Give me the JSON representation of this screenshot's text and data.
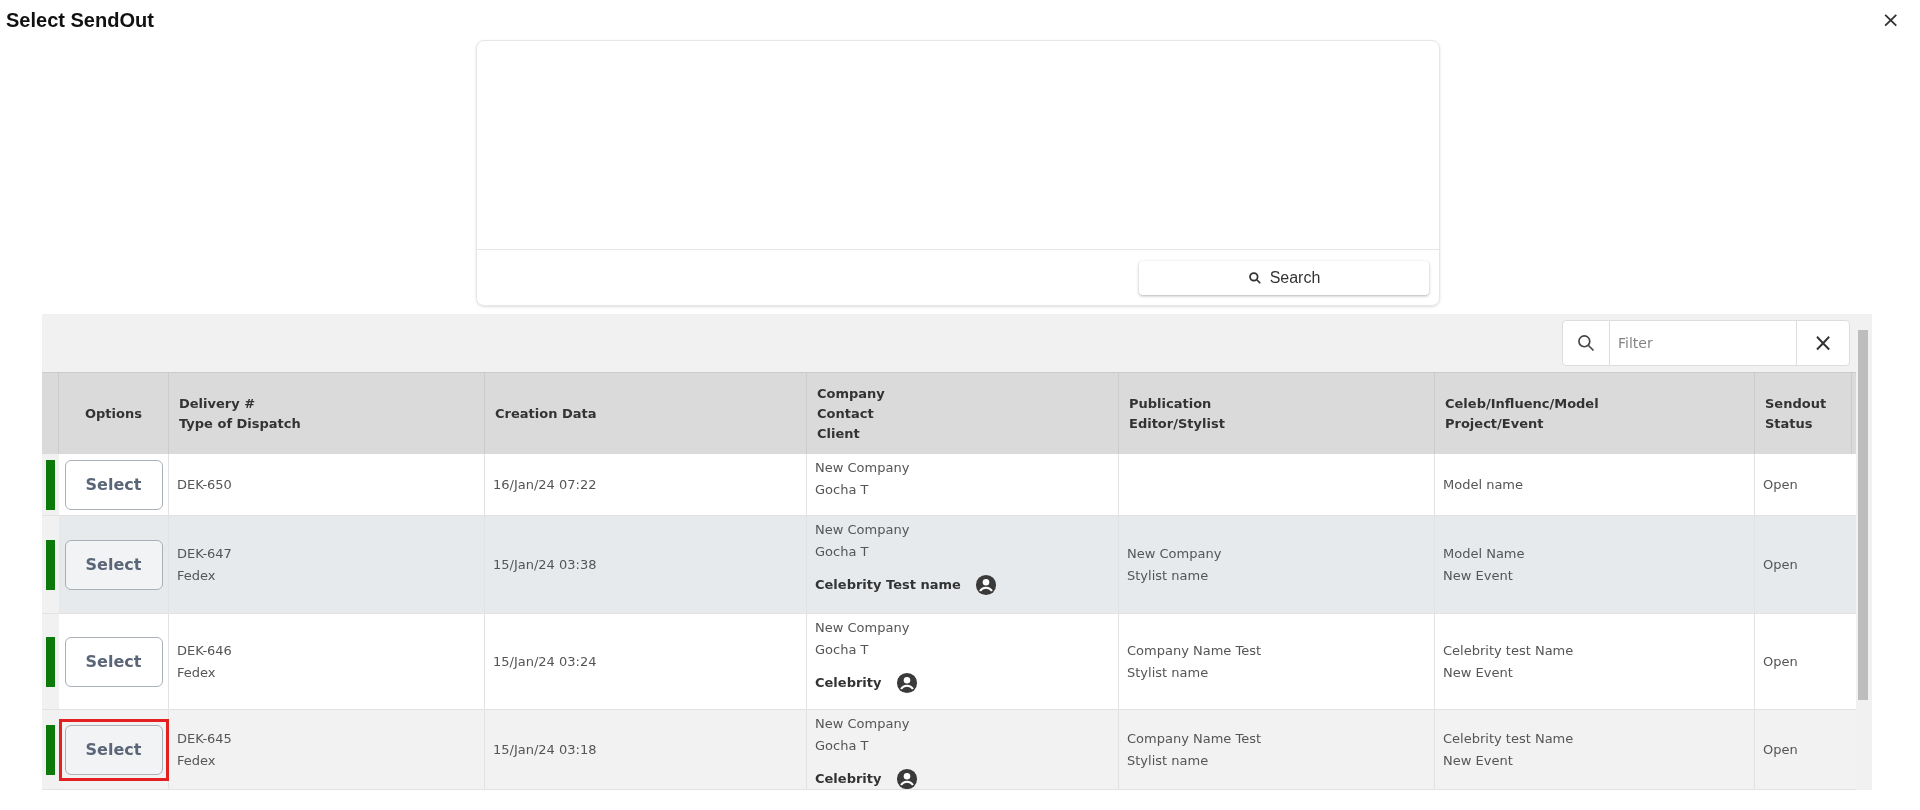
{
  "dialog": {
    "title": "Select SendOut",
    "close": "×"
  },
  "search_panel": {
    "button": "Search"
  },
  "filter": {
    "placeholder": "Filter",
    "clear": "×"
  },
  "table": {
    "columns": [
      {
        "label": "Options"
      },
      {
        "label": "Delivery #\nType of Dispatch"
      },
      {
        "label": "Creation Data"
      },
      {
        "label": "Company\nContact\nClient"
      },
      {
        "label": "Publication\nEditor/Stylist"
      },
      {
        "label": "Celeb/Influenc/Model\nProject/Event"
      },
      {
        "label": "Sendout\nStatus"
      }
    ],
    "rows": [
      {
        "color": "#0b7a0b",
        "hovered": false,
        "outlined": false,
        "button": "Select",
        "delivery": [
          "DEK-650"
        ],
        "created": "16/Jan/24 07:22",
        "company": [
          "New Company",
          "Gocha T"
        ],
        "client": null,
        "publication": [],
        "celeb": [
          "Model name"
        ],
        "status": "Open"
      },
      {
        "color": "#0b7a0b",
        "hovered": true,
        "outlined": false,
        "button": "Select",
        "delivery": [
          "DEK-647",
          "Fedex"
        ],
        "created": "15/Jan/24 03:38",
        "company": [
          "New Company",
          "Gocha T"
        ],
        "client": "Celebrity Test name",
        "publication": [
          "New Company",
          "Stylist name"
        ],
        "celeb": [
          "Model Name",
          "New Event"
        ],
        "status": "Open"
      },
      {
        "color": "#0b7a0b",
        "hovered": false,
        "outlined": false,
        "button": "Select",
        "delivery": [
          "DEK-646",
          "Fedex"
        ],
        "created": "15/Jan/24 03:24",
        "company": [
          "New Company",
          "Gocha T"
        ],
        "client": "Celebrity",
        "publication": [
          "Company Name Test",
          "Stylist name"
        ],
        "celeb": [
          "Celebrity test Name",
          "New Event"
        ],
        "status": "Open"
      },
      {
        "color": "#0b7a0b",
        "hovered": false,
        "outlined": true,
        "button": "Select",
        "delivery": [
          "DEK-645",
          "Fedex"
        ],
        "created": "15/Jan/24 03:18",
        "company": [
          "New Company",
          "Gocha T"
        ],
        "client": "Celebrity",
        "publication": [
          "Company Name Test",
          "Stylist name"
        ],
        "celeb": [
          "Celebrity test Name",
          "New Event"
        ],
        "status": "Open"
      }
    ]
  }
}
